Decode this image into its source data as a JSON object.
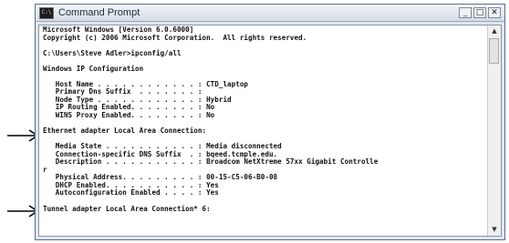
{
  "window": {
    "title": "Command Prompt",
    "minimize_label": "_",
    "maximize_label": "□",
    "close_label": "✕"
  },
  "scrollbar": {
    "up_label": "▲",
    "down_label": "▼"
  },
  "console_lines": [
    "Microsoft Windows [Version 6.0.6000]",
    "Copyright (c) 2006 Microsoft Corporation.  All rights reserved.",
    "",
    "C:\\Users\\Steve Adler>ipconfig/all",
    "",
    "Windows IP Configuration",
    "",
    "   Host Name . . . . . . . . . . . . : CTD_laptop",
    "   Primary Dns Suffix  . . . . . . . :",
    "   Node Type . . . . . . . . . . . . : Hybrid",
    "   IP Routing Enabled. . . . . . . . : No",
    "   WINS Proxy Enabled. . . . . . . . : No",
    "",
    "Ethernet adapter Local Area Connection:",
    "",
    "   Media State . . . . . . . . . . . : Media disconnected",
    "   Connection-specific DNS Suffix  . : bqeed.tcmple.edu.",
    "   Description . . . . . . . . . . . : Broadcom NetXtreme 57xx Gigabit Controlle",
    "r",
    "   Physical Address. . . . . . . . . : 00-15-C5-06-B0-08",
    "   DHCP Enabled. . . . . . . . . . . : Yes",
    "   Autoconfiguration Enabled . . . . : Yes",
    "",
    "Tunnel adapter Local Area Connection* 6:"
  ]
}
